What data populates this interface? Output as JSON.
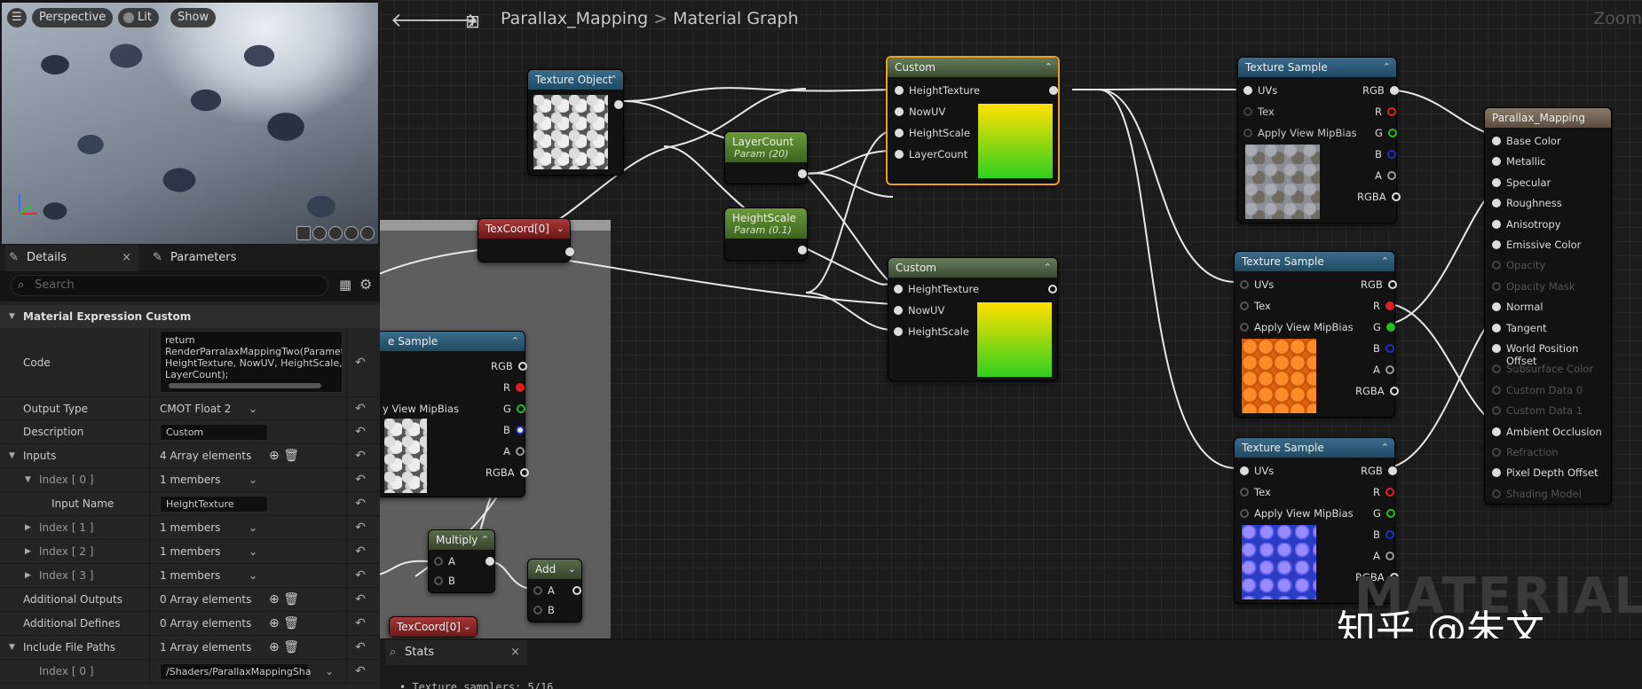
{
  "viewport": {
    "perspective": "Perspective",
    "lit": "Lit",
    "show": "Show"
  },
  "tabs": {
    "details": "Details",
    "parameters": "Parameters"
  },
  "search": {
    "placeholder": "Search"
  },
  "details": {
    "section_title": "Material Expression Custom",
    "code_label": "Code",
    "code_value": "return\nRenderParralaxMappingTwo(Paramete\nHeightTexture, NowUV, HeightScale,\nLayerCount);",
    "output_type_label": "Output Type",
    "output_type_value": "CMOT Float 2",
    "description_label": "Description",
    "description_value": "Custom",
    "inputs_label": "Inputs",
    "inputs_value": "4 Array elements",
    "index0_label": "Index [ 0 ]",
    "index0_value": "1 members",
    "input_name_label": "Input Name",
    "input_name_value": "HeightTexture",
    "index1_label": "Index [ 1 ]",
    "index1_value": "1 members",
    "index2_label": "Index [ 2 ]",
    "index2_value": "1 members",
    "index3_label": "Index [ 3 ]",
    "index3_value": "1 members",
    "additional_outputs_label": "Additional Outputs",
    "additional_outputs_value": "0 Array elements",
    "additional_defines_label": "Additional Defines",
    "additional_defines_value": "0 Array elements",
    "include_paths_label": "Include File Paths",
    "include_paths_value": "1 Array elements",
    "include_index0_label": "Index [ 0 ]",
    "include_index0_value": "/Shaders/ParallaxMappingSha"
  },
  "graph": {
    "breadcrumb_root": "Parallax_Mapping",
    "breadcrumb_sep": ">",
    "breadcrumb_current": "Material Graph",
    "zoom": "Zoom",
    "watermark": "MATERIAL",
    "credit": "知乎 @朱文",
    "stats_tab": "Stats",
    "stats_line": "• Texture samplers: 5/16"
  },
  "nodes": {
    "texture_object": {
      "title": "Texture Object"
    },
    "custom1": {
      "title": "Custom",
      "pins": [
        "HeightTexture",
        "NowUV",
        "HeightScale",
        "LayerCount"
      ]
    },
    "custom2": {
      "title": "Custom",
      "pins": [
        "HeightTexture",
        "NowUV",
        "HeightScale"
      ]
    },
    "layer_count": {
      "title": "LayerCount",
      "sub": "Param (20)"
    },
    "height_scale": {
      "title": "HeightScale",
      "sub": "Param (0.1)"
    },
    "texcoord1": {
      "title": "TexCoord[0]"
    },
    "texcoord2": {
      "title": "TexCoord[0]"
    },
    "multiply": {
      "title": "Multiply",
      "a": "A",
      "b": "B"
    },
    "add": {
      "title": "Add",
      "a": "A",
      "b": "B"
    },
    "partial_sample": {
      "title": "e Sample",
      "mip": "y View MipBias"
    },
    "texture_sample": {
      "title": "Texture Sample",
      "uvs": "UVs",
      "tex": "Tex",
      "mip": "Apply View MipBias",
      "rgb": "RGB",
      "r": "R",
      "g": "G",
      "b": "B",
      "a": "A",
      "rgba": "RGBA"
    },
    "result": {
      "title": "Parallax_Mapping",
      "pins": [
        {
          "label": "Base Color",
          "enabled": true
        },
        {
          "label": "Metallic",
          "enabled": true
        },
        {
          "label": "Specular",
          "enabled": true
        },
        {
          "label": "Roughness",
          "enabled": true
        },
        {
          "label": "Anisotropy",
          "enabled": true
        },
        {
          "label": "Emissive Color",
          "enabled": true
        },
        {
          "label": "Opacity",
          "enabled": false
        },
        {
          "label": "Opacity Mask",
          "enabled": false
        },
        {
          "label": "Normal",
          "enabled": true
        },
        {
          "label": "Tangent",
          "enabled": true
        },
        {
          "label": "World Position Offset",
          "enabled": true
        },
        {
          "label": "Subsurface Color",
          "enabled": false
        },
        {
          "label": "Custom Data 0",
          "enabled": false
        },
        {
          "label": "Custom Data 1",
          "enabled": false
        },
        {
          "label": "Ambient Occlusion",
          "enabled": true
        },
        {
          "label": "Refraction",
          "enabled": false
        },
        {
          "label": "Pixel Depth Offset",
          "enabled": true
        },
        {
          "label": "Shading Model",
          "enabled": false
        }
      ]
    }
  },
  "icons": {
    "menu": "menu-icon",
    "back": "arrow-left-icon",
    "forward": "arrow-right-icon",
    "graph": "graph-icon",
    "reset": "reset-arrow-icon",
    "add": "plus-circle-icon",
    "delete": "trash-icon"
  }
}
